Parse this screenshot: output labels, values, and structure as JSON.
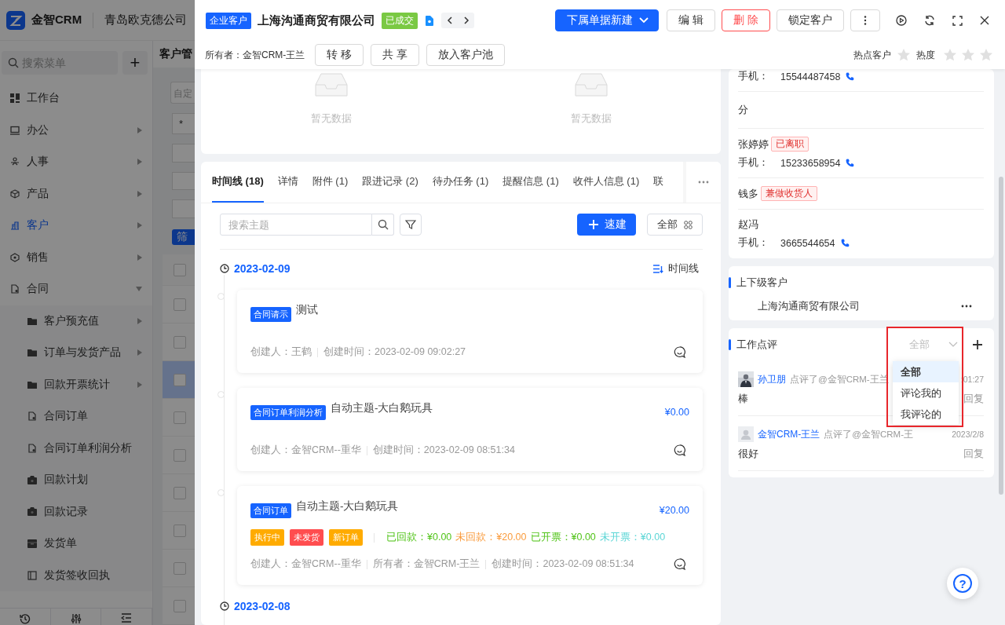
{
  "backdrop": {
    "logo_text": "金智CRM",
    "company": "青岛欧克德公司",
    "search_placeholder": "搜索菜单",
    "add_button": "+",
    "menu": [
      {
        "label": "工作台",
        "kind": "link",
        "selected": false
      },
      {
        "label": "办公",
        "kind": "group",
        "selected": false,
        "expanded": false
      },
      {
        "label": "人事",
        "kind": "group",
        "selected": false,
        "expanded": false
      },
      {
        "label": "产品",
        "kind": "group",
        "selected": false,
        "expanded": false
      },
      {
        "label": "客户",
        "kind": "group",
        "selected": true,
        "expanded": false
      },
      {
        "label": "销售",
        "kind": "group",
        "selected": false,
        "expanded": false
      },
      {
        "label": "合同",
        "kind": "group",
        "selected": false,
        "expanded": true,
        "children": [
          {
            "label": "客户预充值",
            "kind": "group",
            "selected": false,
            "expanded": false
          },
          {
            "label": "订单与发货产品",
            "kind": "group",
            "selected": false,
            "expanded": false
          },
          {
            "label": "回款开票统计",
            "kind": "group",
            "selected": false,
            "expanded": false
          },
          {
            "label": "合同订单",
            "kind": "link",
            "selected": false
          },
          {
            "label": "合同订单利润分析",
            "kind": "link",
            "selected": false
          },
          {
            "label": "回款计划",
            "kind": "link",
            "selected": false
          },
          {
            "label": "回款记录",
            "kind": "link",
            "selected": false
          },
          {
            "label": "发货单",
            "kind": "link",
            "selected": false
          },
          {
            "label": "发货签收回执",
            "kind": "link",
            "selected": false
          }
        ]
      }
    ],
    "page_title": "客户管",
    "field_value": "自定",
    "chips": [
      {
        "kind": "text",
        "text": "*"
      },
      {
        "kind": "blank"
      },
      {
        "kind": "blank"
      },
      {
        "kind": "blank"
      }
    ],
    "filter_button": "筛",
    "all_checked": false,
    "rows": [
      {
        "checked": false,
        "selected": false
      },
      {
        "checked": false,
        "selected": false
      },
      {
        "checked": false,
        "selected": true
      },
      {
        "checked": false,
        "selected": false
      },
      {
        "checked": false,
        "selected": false
      },
      {
        "checked": false,
        "selected": false
      },
      {
        "checked": false,
        "selected": false
      },
      {
        "checked": false,
        "selected": false
      },
      {
        "checked": false,
        "selected": false
      }
    ]
  },
  "header": {
    "type_tag": "企业客户",
    "title": "上海沟通商贸有限公司",
    "status_tag": "已成交",
    "actions": [
      {
        "label": "下属单据新建",
        "kind": "primary"
      },
      {
        "label": "编 辑",
        "kind": "default"
      },
      {
        "label": "删 除",
        "kind": "danger"
      },
      {
        "label": "锁定客户",
        "kind": "default"
      }
    ],
    "owner": "所有者：金智CRM-王兰",
    "owner_actions": [
      "转 移",
      "共 享",
      "放入客户池"
    ],
    "ratings": [
      {
        "label": "热点客户",
        "kind": "toggle",
        "on": false
      },
      {
        "label": "热度",
        "kind": "stars",
        "stars": 0
      }
    ]
  },
  "empty_states": [
    "暂无数据",
    "暂无数据"
  ],
  "tabs": [
    {
      "label": "时间线 (18)",
      "selected": true
    },
    {
      "label": "详情",
      "selected": false
    },
    {
      "label": "附件 (1)",
      "selected": false
    },
    {
      "label": "跟进记录 (2)",
      "selected": false
    },
    {
      "label": "待办任务 (1)",
      "selected": false
    },
    {
      "label": "提醒信息 (1)",
      "selected": false
    },
    {
      "label": "收件人信息 (1)",
      "selected": false
    },
    {
      "label": "联",
      "selected": false
    }
  ],
  "toolbar": {
    "search_placeholder": "搜索主题",
    "quick_create": "速建",
    "all_filter": "全部"
  },
  "timeline": {
    "view_label": "时间线",
    "groups": [
      {
        "date": "2023-02-09",
        "items": [
          {
            "tag": "合同请示",
            "title": "测试",
            "meta": [
              "创建人：王鹤",
              "创建时间：2023-02-09 09:02:27"
            ]
          },
          {
            "tag": "合同订单利润分析",
            "title": "自动主题-大白鹅玩具",
            "amount": "¥0.00",
            "meta": [
              "创建人：金智CRM--重华",
              "创建时间：2023-02-09 08:51:34"
            ]
          },
          {
            "tag": "合同订单",
            "title": "自动主题-大白鹅玩具",
            "amount": "¥20.00",
            "status_tags": [
              {
                "label": "执行中",
                "color": "#ffab00"
              },
              {
                "label": "未发货",
                "color": "#ff4d4f"
              },
              {
                "label": "新订单",
                "color": "#ffab00"
              }
            ],
            "stats": [
              {
                "text": "已回款：¥0.00",
                "color": "#52c41a"
              },
              {
                "text": "未回款：¥20.00",
                "color": "#fa9c3e"
              },
              {
                "text": "已开票：¥0.00",
                "color": "#52c41a"
              },
              {
                "text": "未开票：¥0.00",
                "color": "#5cd6d6"
              }
            ],
            "meta": [
              "创建人：金智CRM--重华",
              "所有者：金智CRM-王兰",
              "创建时间：2023-02-09 08:51:34"
            ]
          }
        ]
      },
      {
        "date": "2023-02-08"
      }
    ]
  },
  "contacts": [
    {
      "phone_label": "手机：",
      "phone": "15544487458"
    },
    {
      "name": "分"
    },
    {
      "name": "张婷婷",
      "badge": "已离职",
      "phone_label": "手机：",
      "phone": "15233658954"
    },
    {
      "name": "钱多",
      "badge": "兼做收货人"
    },
    {
      "name": "赵冯",
      "phone_label": "手机：",
      "phone": "3665544654"
    }
  ],
  "relations": {
    "title": "上下级客户",
    "company": "上海沟通商贸有限公司"
  },
  "reviews": {
    "title": "工作点评",
    "filter": {
      "value": "全部",
      "open": true,
      "highlighted": true,
      "options": [
        {
          "label": "全部",
          "selected": true
        },
        {
          "label": "评论我的",
          "selected": false
        },
        {
          "label": "我评论的",
          "selected": false
        }
      ]
    },
    "comments": [
      {
        "author": "孙卫朋",
        "action": "点评了@金智CRM-王兰",
        "time": ":01:27",
        "text": "棒",
        "reply": "回复"
      },
      {
        "kind": "default",
        "author": "金智CRM-王兰",
        "action": "点评了@金智CRM-王",
        "time": "2023/2/8",
        "text": "很好",
        "reply": "回复"
      }
    ]
  },
  "help_button": "?"
}
